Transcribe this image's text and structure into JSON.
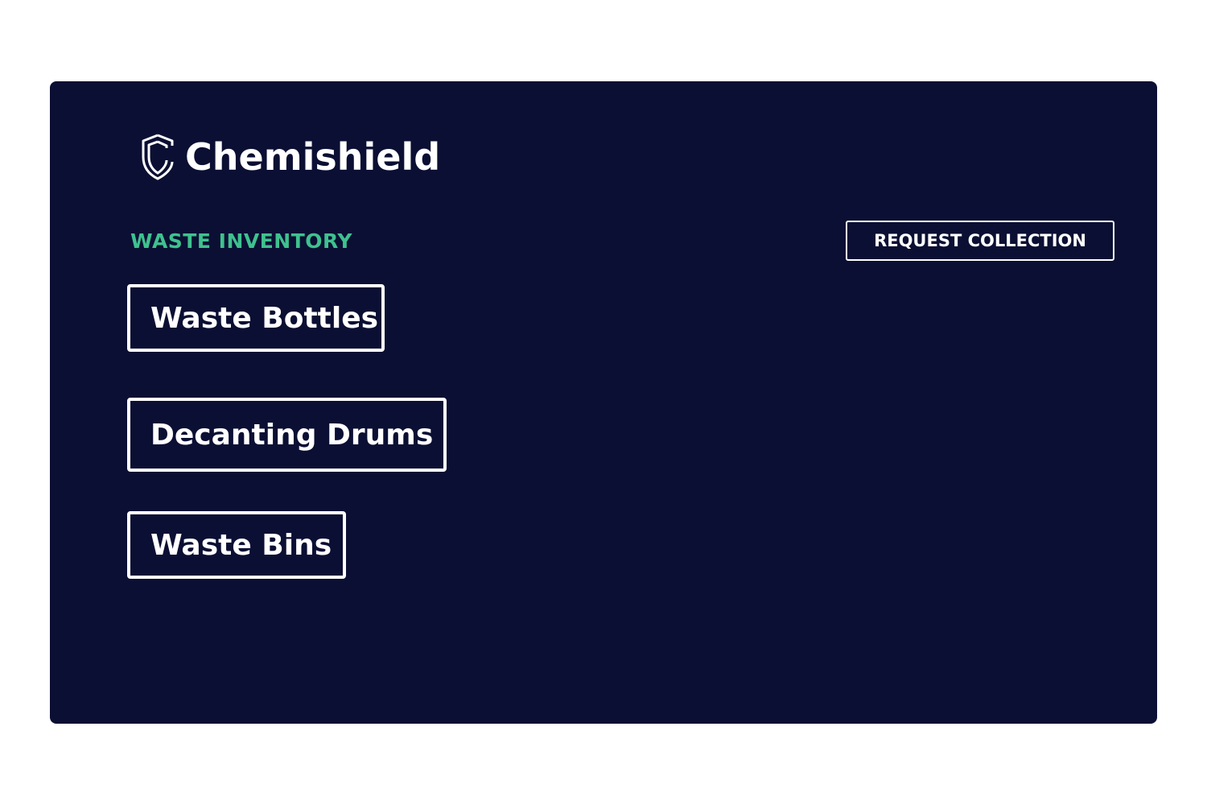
{
  "brand": {
    "name": "Chemishield",
    "logo_icon": "shield-c-logo-icon"
  },
  "section": {
    "title": "WASTE INVENTORY"
  },
  "actions": {
    "request_collection_label": "REQUEST COLLECTION"
  },
  "inventory": {
    "items": [
      {
        "label": "Waste Bottles"
      },
      {
        "label": "Decanting Drums"
      },
      {
        "label": "Waste Bins"
      }
    ]
  },
  "colors": {
    "background": "#0b0f33",
    "accent": "#3fc18f",
    "text": "#ffffff"
  }
}
